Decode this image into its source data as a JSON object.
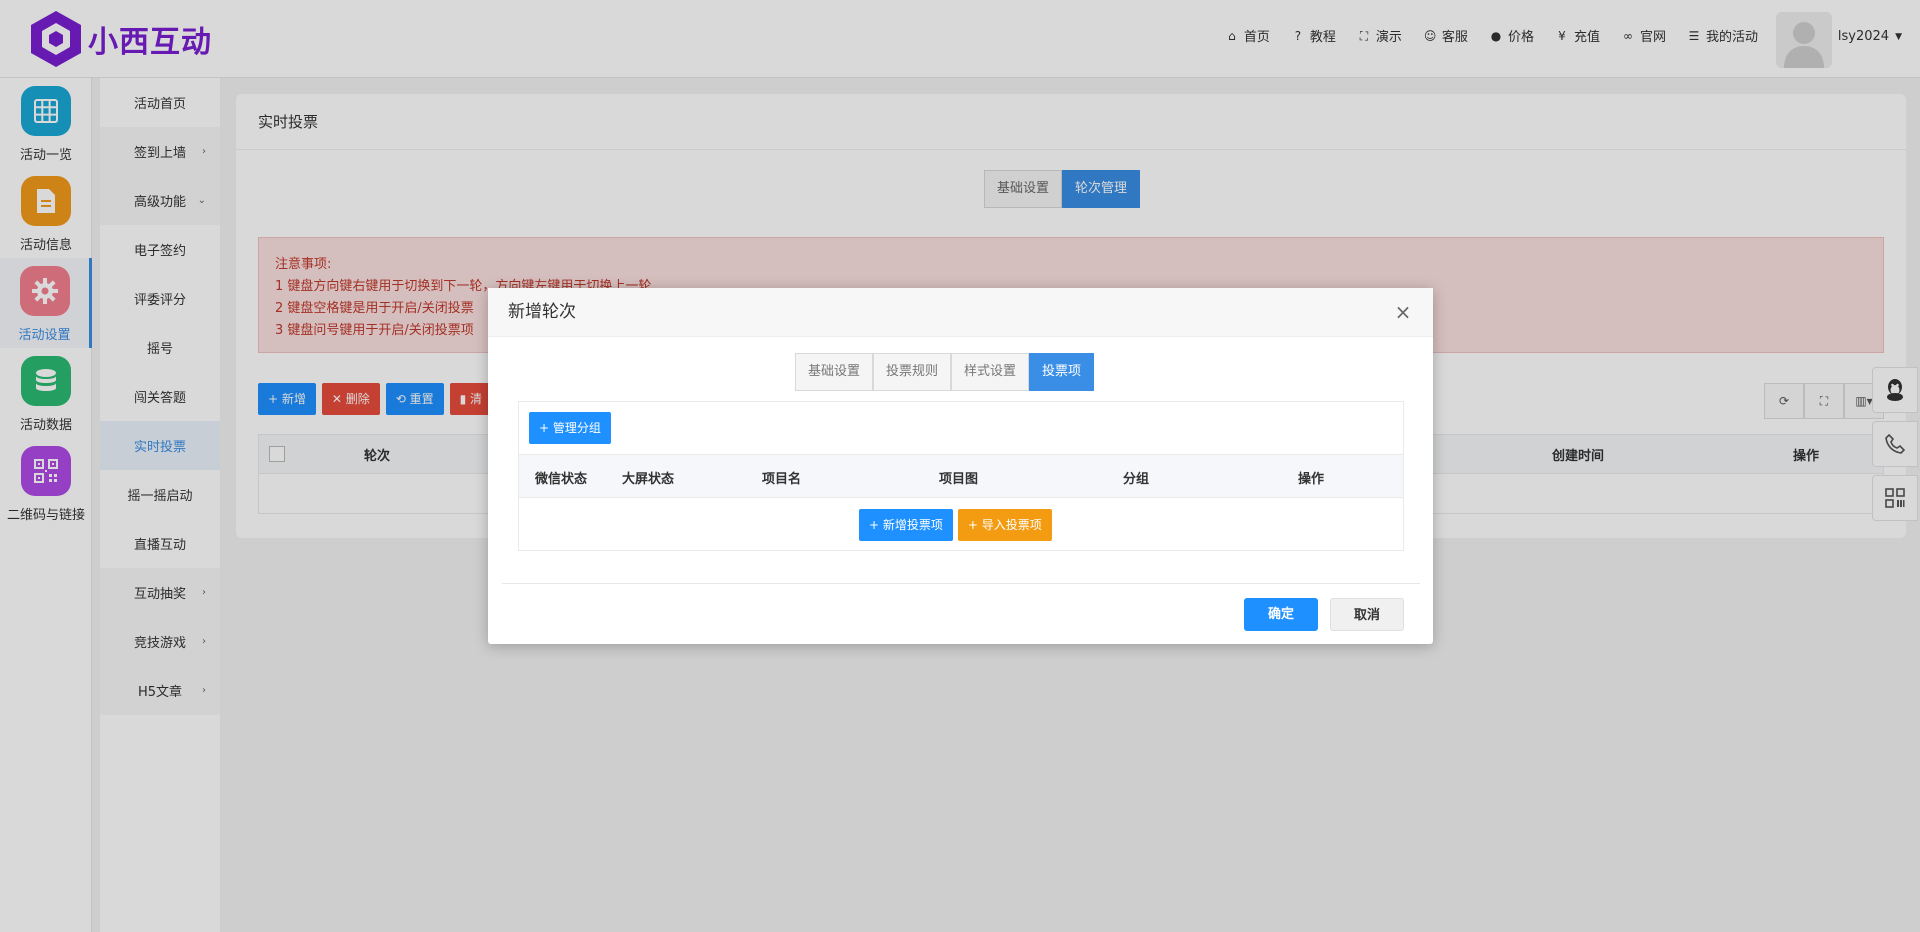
{
  "brand": {
    "name": "小西互动",
    "color": "#7a1fd1"
  },
  "topnav": [
    {
      "icon": "home-icon",
      "glyph": "⌂",
      "label": "首页"
    },
    {
      "icon": "help-icon",
      "glyph": "?",
      "label": "教程"
    },
    {
      "icon": "demo-icon",
      "glyph": "⛶",
      "label": "演示"
    },
    {
      "icon": "service-icon",
      "glyph": "☺",
      "label": "客服"
    },
    {
      "icon": "price-icon",
      "glyph": "●",
      "label": "价格"
    },
    {
      "icon": "yen-icon",
      "glyph": "¥",
      "label": "充值"
    },
    {
      "icon": "link-icon",
      "glyph": "∞",
      "label": "官网"
    },
    {
      "icon": "list-icon",
      "glyph": "☰",
      "label": "我的活动"
    }
  ],
  "user": {
    "name": "lsy2024"
  },
  "iconbar": [
    {
      "label": "活动一览",
      "color": "#1aa8d8",
      "icon": "grid-icon"
    },
    {
      "label": "活动信息",
      "color": "#f29b1c",
      "icon": "document-icon"
    },
    {
      "label": "活动设置",
      "color": "#f27f8f",
      "icon": "gear-icon",
      "active": true
    },
    {
      "label": "活动数据",
      "color": "#2bbb73",
      "icon": "database-icon"
    },
    {
      "label": "二维码与链接",
      "color": "#b04be8",
      "icon": "qrcode-icon"
    }
  ],
  "subbar": [
    {
      "label": "活动首页"
    },
    {
      "label": "签到上墙",
      "chev": "›",
      "group": true
    },
    {
      "label": "高级功能",
      "chev": "⌄",
      "group": true
    },
    {
      "label": "电子签约"
    },
    {
      "label": "评委评分"
    },
    {
      "label": "摇号"
    },
    {
      "label": "闯关答题"
    },
    {
      "label": "实时投票",
      "active": true
    },
    {
      "label": "摇一摇启动"
    },
    {
      "label": "直播互动"
    },
    {
      "label": "互动抽奖",
      "chev": "›",
      "group": true
    },
    {
      "label": "竞技游戏",
      "chev": "›",
      "group": true
    },
    {
      "label": "H5文章",
      "chev": "›",
      "group": true
    }
  ],
  "page": {
    "title": "实时投票",
    "tabs": [
      "基础设置",
      "轮次管理"
    ],
    "notice": {
      "heading": "注意事项:",
      "lines": [
        "1 键盘方向键右键用于切换到下一轮，方向键左键用于切换上一轮",
        "2 键盘空格键是用于开启/关闭投票",
        "3 键盘问号键用于开启/关闭投票项"
      ]
    },
    "toolbar": {
      "add": "+ 新增",
      "delete": "✕ 删除",
      "reset": "⟲ 重置",
      "clear": "▮ 清"
    },
    "table": {
      "col_round": "轮次",
      "col_created": "创建时间",
      "col_action": "操作"
    }
  },
  "modal": {
    "title": "新增轮次",
    "tabs": [
      "基础设置",
      "投票规则",
      "样式设置",
      "投票项"
    ],
    "manage_group": "+ 管理分组",
    "columns": [
      "微信状态",
      "大屏状态",
      "项目名",
      "项目图",
      "分组",
      "操作"
    ],
    "add_item": "+ 新增投票项",
    "import_item": "+ 导入投票项",
    "ok": "确定",
    "cancel": "取消"
  }
}
